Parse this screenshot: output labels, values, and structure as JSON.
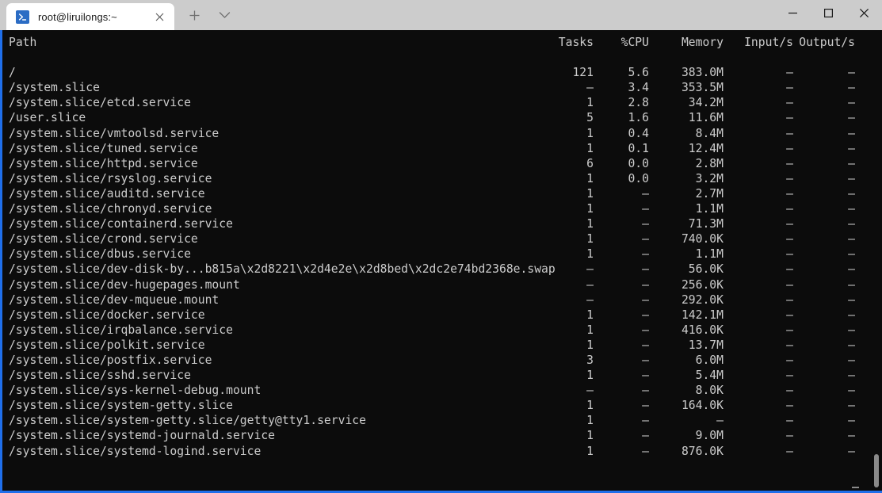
{
  "window": {
    "titlebar": {
      "tab": {
        "title": "root@liruilongs:~",
        "icon": "powershell-prompt-icon",
        "close_label": "✕"
      },
      "new_tab_label": "+",
      "dropdown_label": "⌄",
      "controls": {
        "minimize": "—",
        "maximize": "□",
        "close": "✕"
      }
    }
  },
  "terminal": {
    "columns": [
      "Path",
      "Tasks",
      "%CPU",
      "Memory",
      "Input/s",
      "Output/s"
    ],
    "rows": [
      {
        "path": "/",
        "tasks": "121",
        "cpu": "5.6",
        "memory": "383.0M",
        "input": "–",
        "output": "–"
      },
      {
        "path": "/system.slice",
        "tasks": "–",
        "cpu": "3.4",
        "memory": "353.5M",
        "input": "–",
        "output": "–"
      },
      {
        "path": "/system.slice/etcd.service",
        "tasks": "1",
        "cpu": "2.8",
        "memory": "34.2M",
        "input": "–",
        "output": "–"
      },
      {
        "path": "/user.slice",
        "tasks": "5",
        "cpu": "1.6",
        "memory": "11.6M",
        "input": "–",
        "output": "–"
      },
      {
        "path": "/system.slice/vmtoolsd.service",
        "tasks": "1",
        "cpu": "0.4",
        "memory": "8.4M",
        "input": "–",
        "output": "–"
      },
      {
        "path": "/system.slice/tuned.service",
        "tasks": "1",
        "cpu": "0.1",
        "memory": "12.4M",
        "input": "–",
        "output": "–"
      },
      {
        "path": "/system.slice/httpd.service",
        "tasks": "6",
        "cpu": "0.0",
        "memory": "2.8M",
        "input": "–",
        "output": "–"
      },
      {
        "path": "/system.slice/rsyslog.service",
        "tasks": "1",
        "cpu": "0.0",
        "memory": "3.2M",
        "input": "–",
        "output": "–"
      },
      {
        "path": "/system.slice/auditd.service",
        "tasks": "1",
        "cpu": "–",
        "memory": "2.7M",
        "input": "–",
        "output": "–"
      },
      {
        "path": "/system.slice/chronyd.service",
        "tasks": "1",
        "cpu": "–",
        "memory": "1.1M",
        "input": "–",
        "output": "–"
      },
      {
        "path": "/system.slice/containerd.service",
        "tasks": "1",
        "cpu": "–",
        "memory": "71.3M",
        "input": "–",
        "output": "–"
      },
      {
        "path": "/system.slice/crond.service",
        "tasks": "1",
        "cpu": "–",
        "memory": "740.0K",
        "input": "–",
        "output": "–"
      },
      {
        "path": "/system.slice/dbus.service",
        "tasks": "1",
        "cpu": "–",
        "memory": "1.1M",
        "input": "–",
        "output": "–"
      },
      {
        "path": "/system.slice/dev-disk-by...b815a\\x2d8221\\x2d4e2e\\x2d8bed\\x2dc2e74bd2368e.swap",
        "tasks": "–",
        "cpu": "–",
        "memory": "56.0K",
        "input": "–",
        "output": "–"
      },
      {
        "path": "/system.slice/dev-hugepages.mount",
        "tasks": "–",
        "cpu": "–",
        "memory": "256.0K",
        "input": "–",
        "output": "–"
      },
      {
        "path": "/system.slice/dev-mqueue.mount",
        "tasks": "–",
        "cpu": "–",
        "memory": "292.0K",
        "input": "–",
        "output": "–"
      },
      {
        "path": "/system.slice/docker.service",
        "tasks": "1",
        "cpu": "–",
        "memory": "142.1M",
        "input": "–",
        "output": "–"
      },
      {
        "path": "/system.slice/irqbalance.service",
        "tasks": "1",
        "cpu": "–",
        "memory": "416.0K",
        "input": "–",
        "output": "–"
      },
      {
        "path": "/system.slice/polkit.service",
        "tasks": "1",
        "cpu": "–",
        "memory": "13.7M",
        "input": "–",
        "output": "–"
      },
      {
        "path": "/system.slice/postfix.service",
        "tasks": "3",
        "cpu": "–",
        "memory": "6.0M",
        "input": "–",
        "output": "–"
      },
      {
        "path": "/system.slice/sshd.service",
        "tasks": "1",
        "cpu": "–",
        "memory": "5.4M",
        "input": "–",
        "output": "–"
      },
      {
        "path": "/system.slice/sys-kernel-debug.mount",
        "tasks": "–",
        "cpu": "–",
        "memory": "8.0K",
        "input": "–",
        "output": "–"
      },
      {
        "path": "/system.slice/system-getty.slice",
        "tasks": "1",
        "cpu": "–",
        "memory": "164.0K",
        "input": "–",
        "output": "–"
      },
      {
        "path": "/system.slice/system-getty.slice/getty@tty1.service",
        "tasks": "1",
        "cpu": "–",
        "memory": "–",
        "input": "–",
        "output": "–"
      },
      {
        "path": "/system.slice/systemd-journald.service",
        "tasks": "1",
        "cpu": "–",
        "memory": "9.0M",
        "input": "–",
        "output": "–"
      },
      {
        "path": "/system.slice/systemd-logind.service",
        "tasks": "1",
        "cpu": "–",
        "memory": "876.0K",
        "input": "–",
        "output": "–"
      }
    ]
  },
  "colors": {
    "accent": "#1f6feb",
    "titlebar_bg": "#cccccc",
    "terminal_bg": "#0c0c0c",
    "terminal_fg": "#cccccc",
    "tab_icon_bg": "#2b6cc4"
  }
}
